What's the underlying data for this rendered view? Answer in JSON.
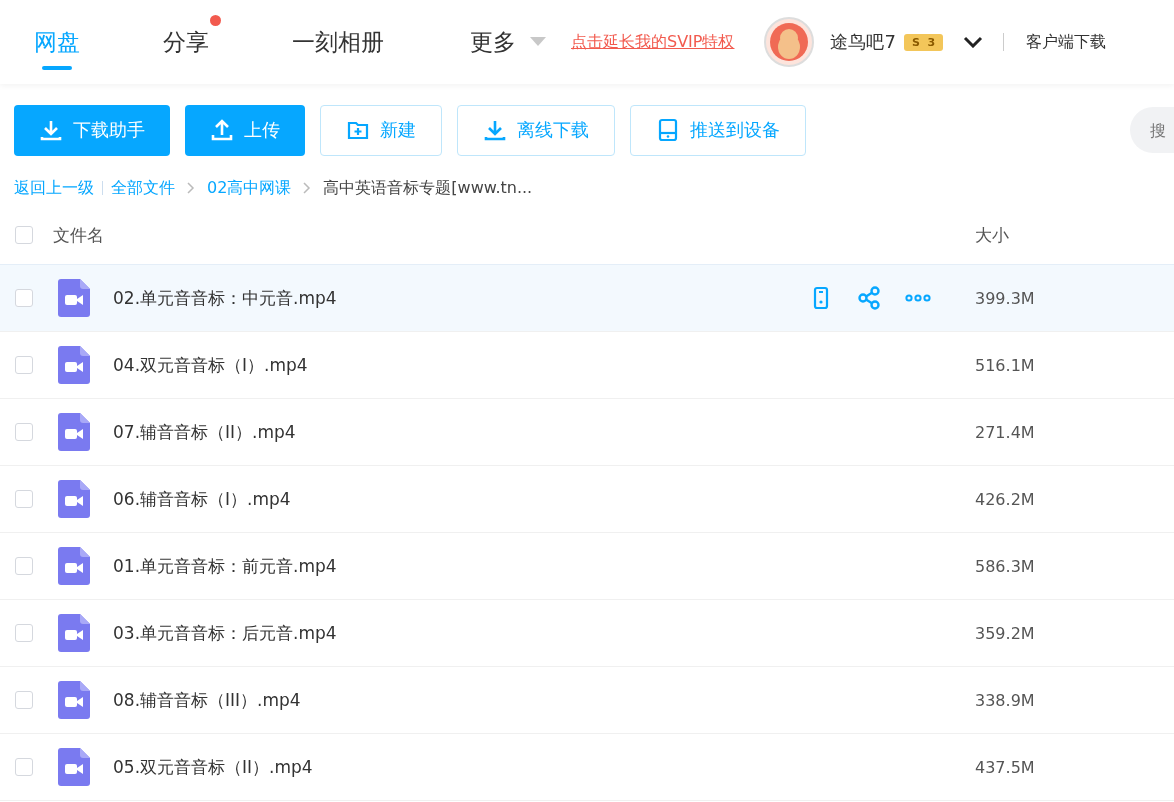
{
  "nav": {
    "tabs": [
      {
        "label": "网盘",
        "selected": true,
        "badge": false
      },
      {
        "label": "分享",
        "selected": false,
        "badge": true
      },
      {
        "label": "一刻相册",
        "selected": false,
        "badge": false
      },
      {
        "label": "更多",
        "selected": false,
        "badge": false,
        "dropdown": true
      }
    ],
    "promo": "点击延长我的SVIP特权",
    "user": {
      "name": "途鸟吧7",
      "badge_letter": "S",
      "level": "3"
    },
    "client_download": "客户端下载"
  },
  "toolbar": {
    "buttons": [
      {
        "label": "下载助手",
        "kind": "primary"
      },
      {
        "label": "上传",
        "kind": "primary"
      },
      {
        "label": "新建",
        "kind": "outline"
      },
      {
        "label": "离线下载",
        "kind": "outline"
      },
      {
        "label": "推送到设备",
        "kind": "outline"
      }
    ],
    "search": {
      "placeholder": "搜"
    }
  },
  "breadcrumb": {
    "back": "返回上一级",
    "items": [
      "全部文件",
      "02高中网课",
      "高中英语音标专题[www.tn..."
    ]
  },
  "table": {
    "columns": [
      "文件名",
      "大小"
    ],
    "all_checked": false,
    "rows": [
      {
        "name": "02.单元音音标：中元音.mp4",
        "size": "399.3M",
        "checked": false,
        "hovered": true
      },
      {
        "name": "04.双元音音标（I）.mp4",
        "size": "516.1M",
        "checked": false,
        "hovered": false
      },
      {
        "name": "07.辅音音标（II）.mp4",
        "size": "271.4M",
        "checked": false,
        "hovered": false
      },
      {
        "name": "06.辅音音标（I）.mp4",
        "size": "426.2M",
        "checked": false,
        "hovered": false
      },
      {
        "name": "01.单元音音标：前元音.mp4",
        "size": "586.3M",
        "checked": false,
        "hovered": false
      },
      {
        "name": "03.单元音音标：后元音.mp4",
        "size": "359.2M",
        "checked": false,
        "hovered": false
      },
      {
        "name": "08.辅音音标（III）.mp4",
        "size": "338.9M",
        "checked": false,
        "hovered": false
      },
      {
        "name": "05.双元音音标（II）.mp4",
        "size": "437.5M",
        "checked": false,
        "hovered": false
      }
    ]
  }
}
